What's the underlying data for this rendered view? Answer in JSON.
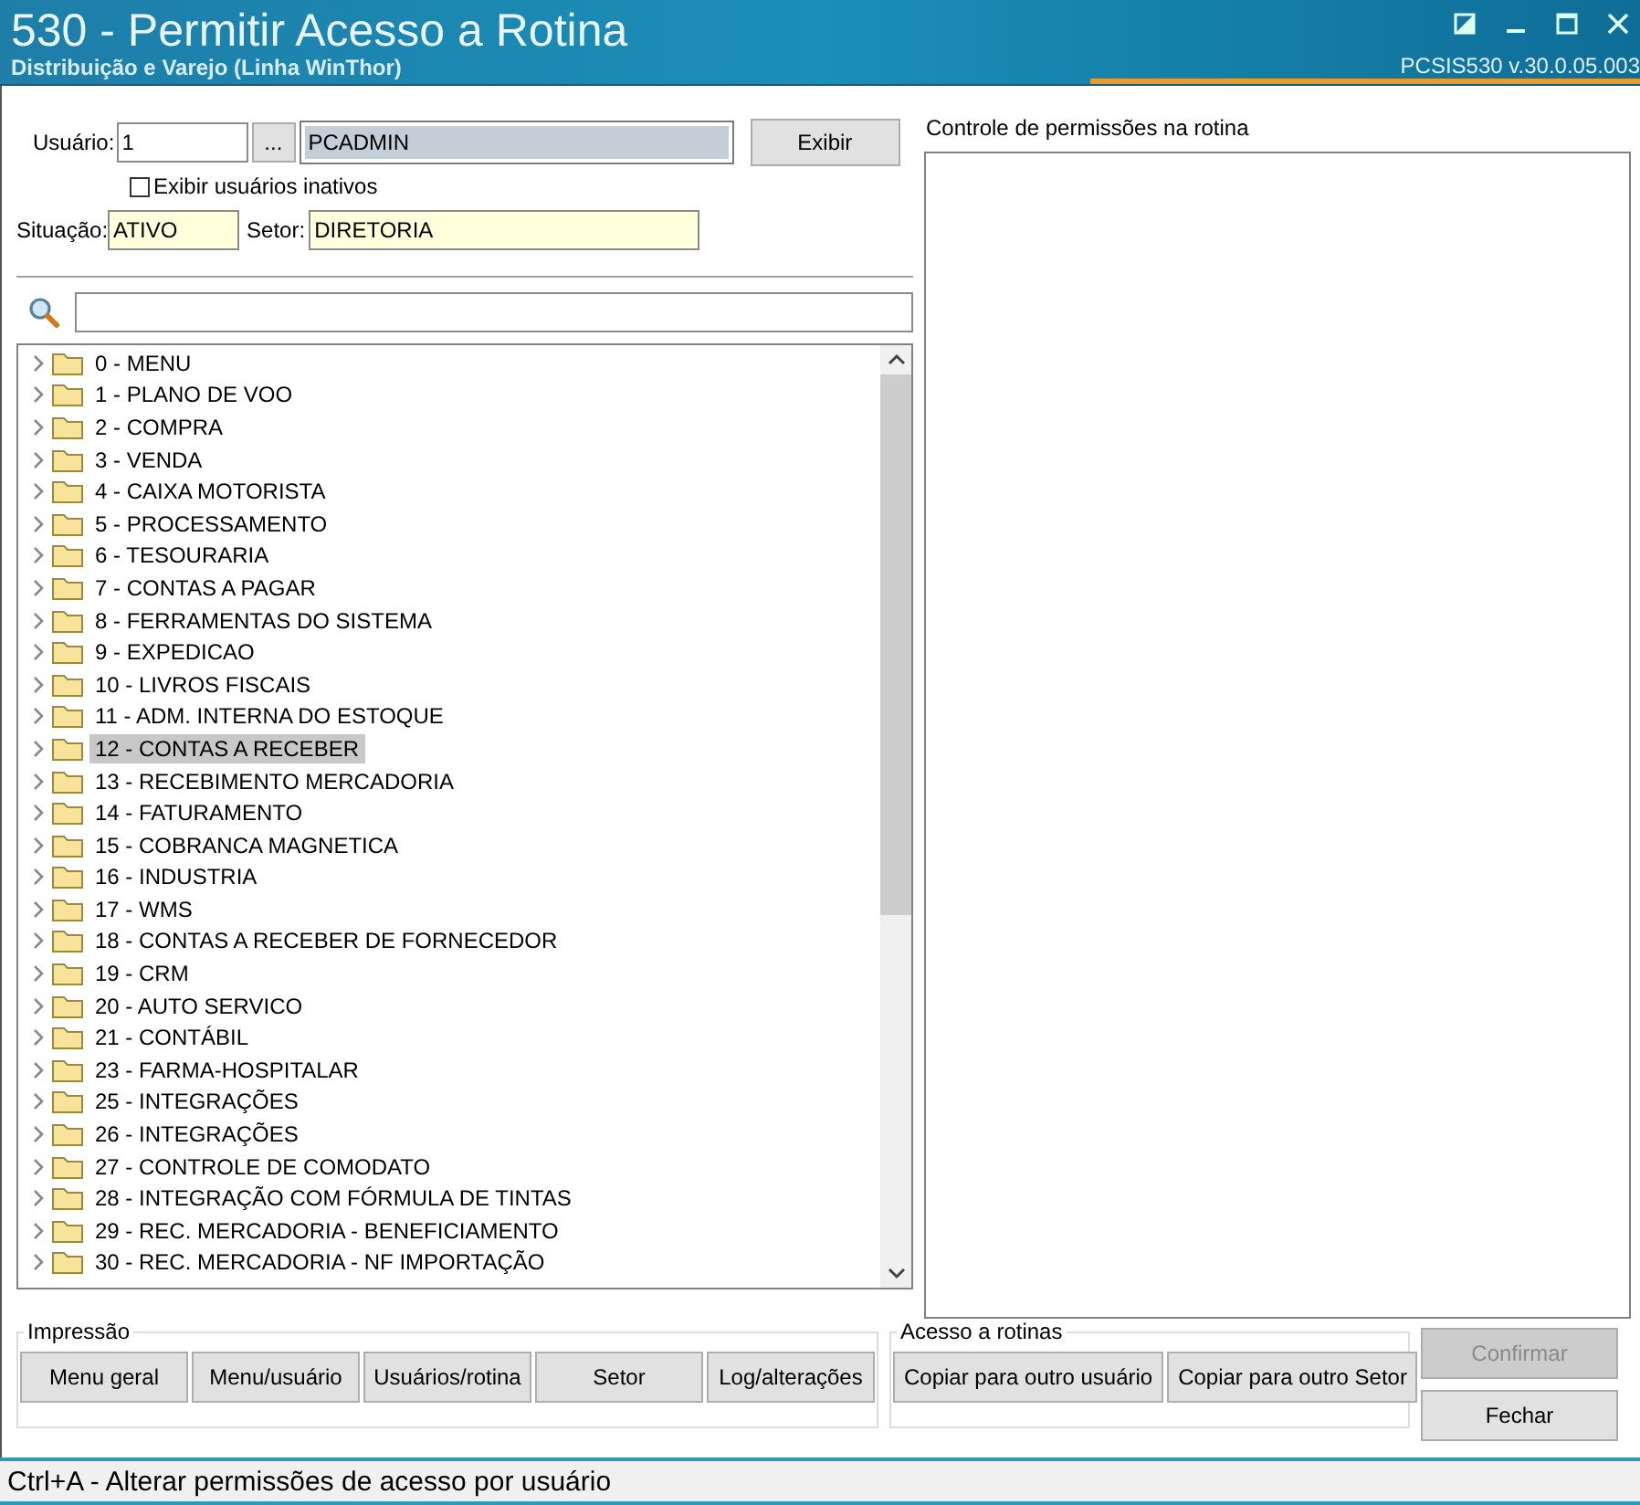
{
  "window": {
    "title": "530 - Permitir Acesso a Rotina",
    "subtitle": "Distribuição e Varejo (Linha WinThor)",
    "version": "PCSIS530  v.30.0.05.003"
  },
  "user": {
    "label": "Usuário:",
    "code": "1",
    "lookup": "...",
    "name": "PCADMIN",
    "show_button": "Exibir",
    "inactive_label": "Exibir usuários inativos",
    "inactive_checked": false,
    "status_label": "Situação:",
    "status": "ATIVO",
    "sector_label": "Setor:",
    "sector": "DIRETORIA"
  },
  "permissions": {
    "title": "Controle de permissões na rotina"
  },
  "tree": [
    {
      "label": "0 - MENU",
      "selected": false
    },
    {
      "label": "1 - PLANO DE VOO",
      "selected": false
    },
    {
      "label": "2 - COMPRA",
      "selected": false
    },
    {
      "label": "3 - VENDA",
      "selected": false
    },
    {
      "label": "4 - CAIXA MOTORISTA",
      "selected": false
    },
    {
      "label": "5 - PROCESSAMENTO",
      "selected": false
    },
    {
      "label": "6 - TESOURARIA",
      "selected": false
    },
    {
      "label": "7 - CONTAS A PAGAR",
      "selected": false
    },
    {
      "label": "8 - FERRAMENTAS DO SISTEMA",
      "selected": false
    },
    {
      "label": "9 - EXPEDICAO",
      "selected": false
    },
    {
      "label": "10 - LIVROS FISCAIS",
      "selected": false
    },
    {
      "label": "11 - ADM. INTERNA DO ESTOQUE",
      "selected": false
    },
    {
      "label": "12 - CONTAS A RECEBER",
      "selected": true
    },
    {
      "label": "13 - RECEBIMENTO MERCADORIA",
      "selected": false
    },
    {
      "label": "14 - FATURAMENTO",
      "selected": false
    },
    {
      "label": "15 - COBRANCA MAGNETICA",
      "selected": false
    },
    {
      "label": "16 - INDUSTRIA",
      "selected": false
    },
    {
      "label": "17 - WMS",
      "selected": false
    },
    {
      "label": "18 - CONTAS A RECEBER DE FORNECEDOR",
      "selected": false
    },
    {
      "label": "19 - CRM",
      "selected": false
    },
    {
      "label": "20 - AUTO SERVICO",
      "selected": false
    },
    {
      "label": "21 - CONTÁBIL",
      "selected": false
    },
    {
      "label": "23 - FARMA-HOSPITALAR",
      "selected": false
    },
    {
      "label": "25 - INTEGRAÇÕES",
      "selected": false
    },
    {
      "label": "26 - INTEGRAÇÕES",
      "selected": false
    },
    {
      "label": "27 - CONTROLE DE COMODATO",
      "selected": false
    },
    {
      "label": "28 - INTEGRAÇÃO COM FÓRMULA DE TINTAS",
      "selected": false
    },
    {
      "label": "29 - REC. MERCADORIA - BENEFICIAMENTO",
      "selected": false
    },
    {
      "label": "30 - REC. MERCADORIA - NF IMPORTAÇÃO",
      "selected": false
    }
  ],
  "print_group": {
    "title": "Impressão",
    "buttons": [
      "Menu geral",
      "Menu/usuário",
      "Usuários/rotina",
      "Setor",
      "Log/alterações"
    ]
  },
  "access_group": {
    "title": "Acesso a rotinas",
    "buttons": [
      "Copiar para outro usuário",
      "Copiar para outro Setor"
    ]
  },
  "actions": [
    {
      "label": "Confirmar",
      "disabled": true
    },
    {
      "label": "Fechar",
      "disabled": false
    }
  ],
  "status_bar": "Ctrl+A - Alterar permissões de acesso por usuário"
}
